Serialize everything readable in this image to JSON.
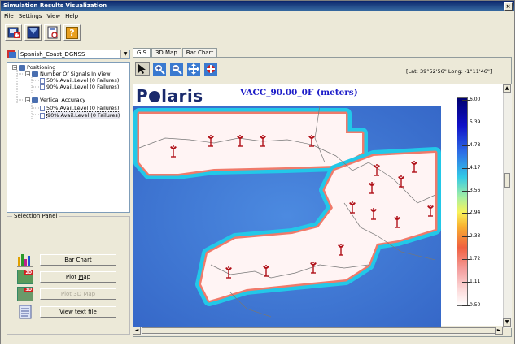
{
  "window": {
    "title": "Simulation Results Visualization",
    "close_glyph": "×"
  },
  "menu": [
    {
      "underline": "F",
      "rest": "ile"
    },
    {
      "underline": "S",
      "rest": "ettings"
    },
    {
      "underline": "V",
      "rest": "iew"
    },
    {
      "underline": "H",
      "rest": "elp"
    }
  ],
  "toolbar": {
    "icons": [
      "open-icon",
      "screen-icon",
      "report-icon",
      "help-icon"
    ],
    "help_glyph": "?"
  },
  "scenario": {
    "selected": "Spanish_Coast_DGNSS",
    "arrow": "▼"
  },
  "tree": {
    "root": "Positioning",
    "n1": "Number Of Signals In View",
    "n1a": "50% Avail.Level (0 Failures)",
    "n1b": "90% Avail.Level (0 Failures)",
    "n2": "Vertical Accuracy",
    "n2a": "50% Avail.Level (0 Failures)",
    "n2b": "90% Avail.Level (0 Failures)",
    "minus": "−"
  },
  "selection_panel": {
    "title": "Selection Panel",
    "bar_chart": "Bar Chart",
    "plot_map_u": "M",
    "plot_map_pre": "Plot ",
    "plot_map_post": "ap",
    "plot_3d": "Plot 3D Map",
    "view_text": "View text file",
    "badge_2d": "2D",
    "badge_3d": "3D"
  },
  "tabs": [
    "GIS",
    "3D Map",
    "Bar Chart"
  ],
  "map": {
    "coords": "[Lat: 39°52'56\" Long: -1°11'46\"]",
    "logo_p": "P",
    "logo_rest": "laris",
    "title": "VACC_90.00_0F (meters)",
    "colors": {
      "sea": "#3a7ad6",
      "land_fringe": "#22c8e8",
      "coverage": "#fff4f4",
      "site": "#b01018"
    }
  },
  "colorbar": {
    "labels": [
      "6.00",
      "5.39",
      "4.78",
      "4.17",
      "3.56",
      "2.94",
      "2.33",
      "1.72",
      "1.11",
      "0.50"
    ]
  },
  "scroll": {
    "up": "▲",
    "down": "▼",
    "left": "◄",
    "right": "►"
  }
}
